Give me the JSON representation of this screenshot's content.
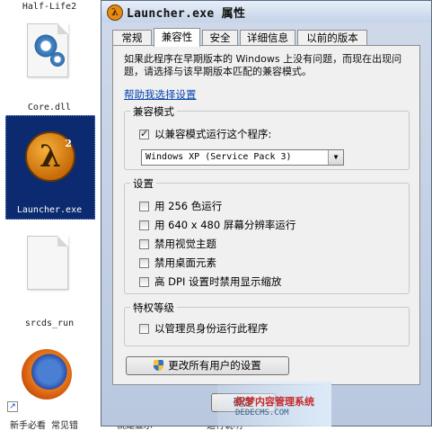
{
  "desktop": {
    "top_label": "Half-Life2",
    "icons": [
      {
        "label": "Core.dll",
        "icon": "gear-file-icon"
      },
      {
        "label": "Launcher.exe",
        "icon": "half-life-icon"
      },
      {
        "label": "srcds_run",
        "icon": "blank-file-icon"
      },
      {
        "label": "",
        "icon": "firefox-icon"
      }
    ],
    "bottom_labels": [
      "新手必看 常见错",
      "就是显示",
      "运行说明"
    ]
  },
  "window": {
    "title": "Launcher.exe 属性",
    "tabs": [
      "常规",
      "兼容性",
      "安全",
      "详细信息",
      "以前的版本"
    ],
    "active_tab": "兼容性",
    "intro": "如果此程序在早期版本的 Windows 上没有问题，而现在出现问题，请选择与该早期版本匹配的兼容模式。",
    "help_link": "帮助我选择设置",
    "compat_group": {
      "legend": "兼容模式",
      "checkbox_label": "以兼容模式运行这个程序:",
      "checked": true,
      "selected_os": "Windows XP (Service Pack 3)"
    },
    "settings_group": {
      "legend": "设置",
      "options": [
        {
          "label": "用 256 色运行",
          "checked": false
        },
        {
          "label": "用 640 x 480 屏幕分辨率运行",
          "checked": false
        },
        {
          "label": "禁用视觉主题",
          "checked": false
        },
        {
          "label": "禁用桌面元素",
          "checked": false
        },
        {
          "label": "高 DPI 设置时禁用显示缩放",
          "checked": false
        }
      ]
    },
    "privilege_group": {
      "legend": "特权等级",
      "option": {
        "label": "以管理员身份运行此程序",
        "checked": false
      }
    },
    "all_users_button": "更改所有用户的设置",
    "ok_button": "确定"
  },
  "watermark": {
    "text": "织梦内容管理系统",
    "sub": "DEDECMS.COM"
  }
}
